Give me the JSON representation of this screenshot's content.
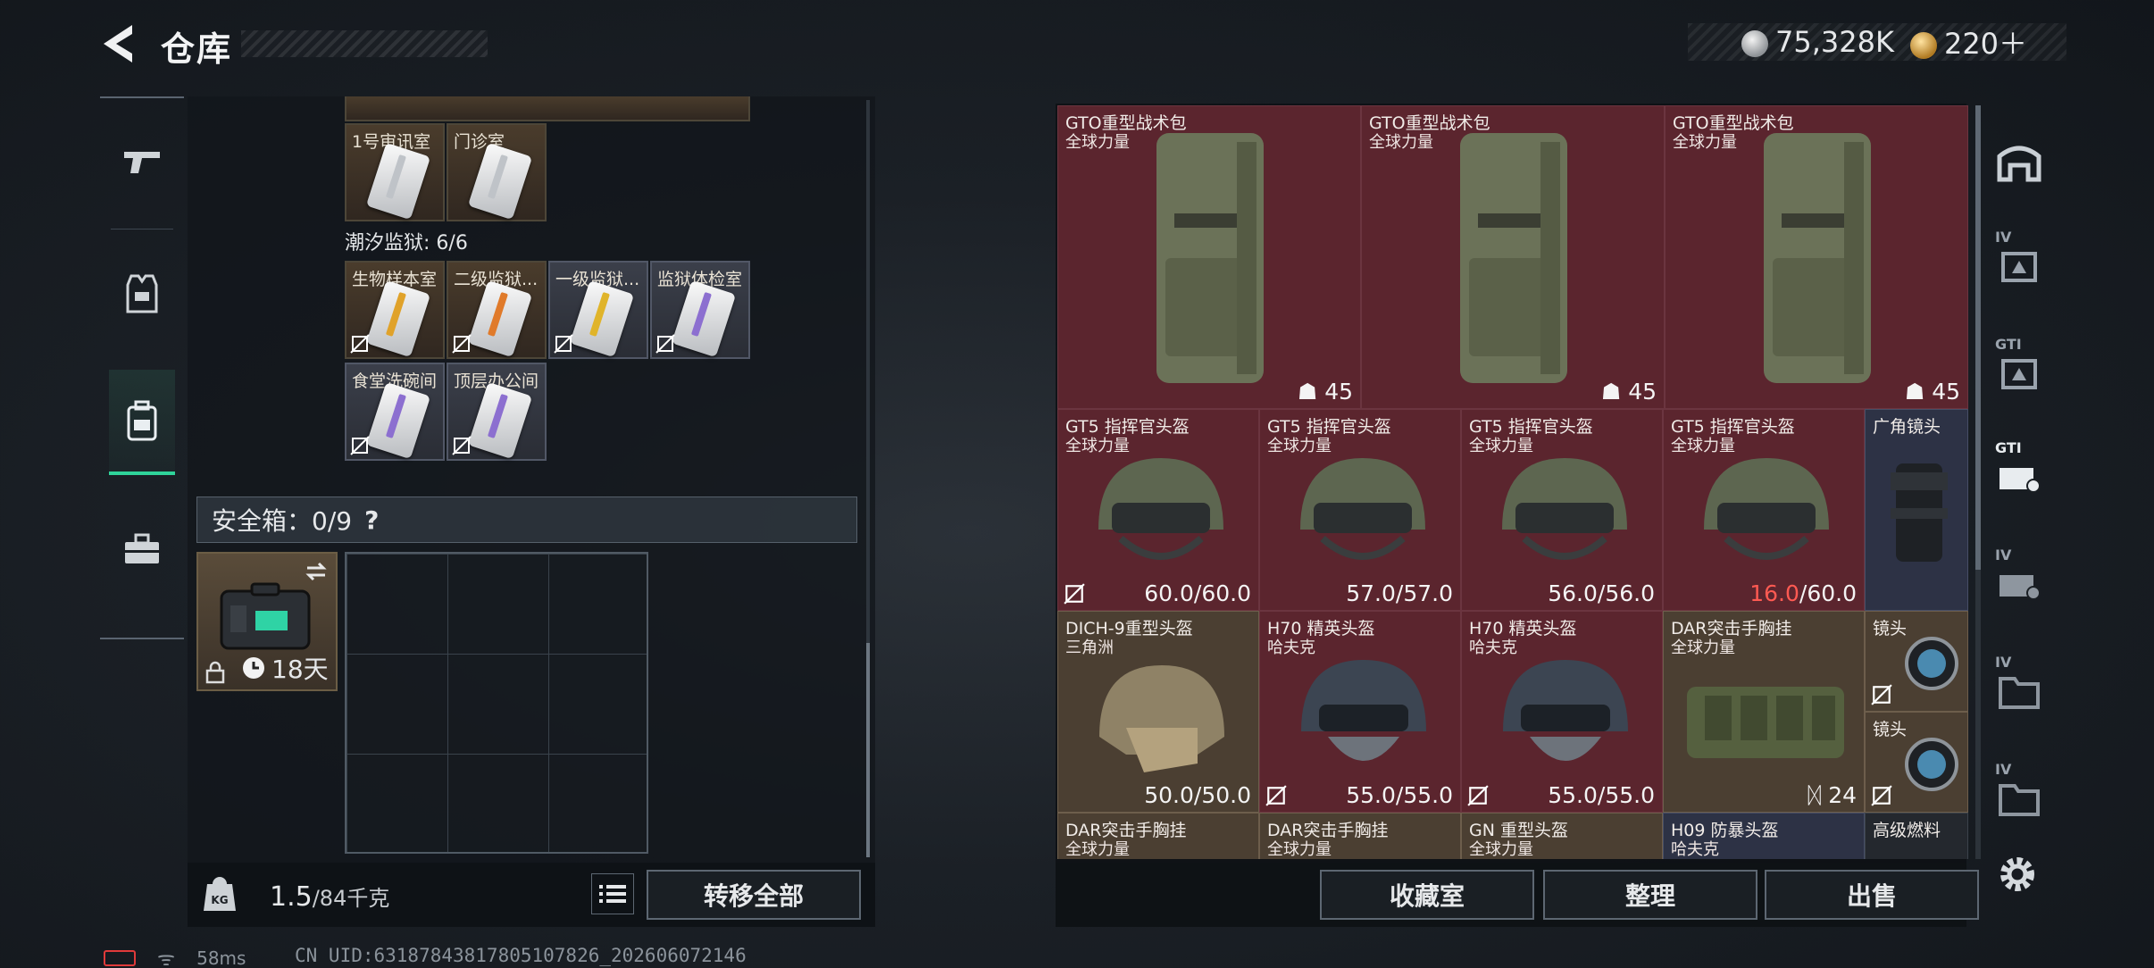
{
  "header": {
    "title": "仓库"
  },
  "currency": {
    "silver": "75,328K",
    "gold": "220＋"
  },
  "rail": {
    "items": [
      "weapons",
      "gear",
      "containers",
      "toolbox"
    ],
    "active": 2
  },
  "keys": {
    "row1": [
      {
        "label": "1号审讯室"
      },
      {
        "label": "门诊室"
      }
    ],
    "section_title": "潮汐监狱: 6/6",
    "row2": [
      {
        "label": "生物样本室"
      },
      {
        "label": "二级监狱..."
      },
      {
        "label": "一级监狱..."
      },
      {
        "label": "监狱体检室"
      }
    ],
    "row3": [
      {
        "label": "食堂洗碗间"
      },
      {
        "label": "顶层办公间"
      }
    ]
  },
  "safebox": {
    "label": "安全箱：0/9",
    "help": "?",
    "timer": "18天"
  },
  "bottom_left": {
    "weight": "1.5",
    "capacity": "/84千克",
    "transfer_label": "转移全部"
  },
  "stash": {
    "backpacks": [
      {
        "name": "GTO重型战术包",
        "sub": "全球力量",
        "stat": "45"
      },
      {
        "name": "GTO重型战术包",
        "sub": "全球力量",
        "stat": "45"
      },
      {
        "name": "GTO重型战术包",
        "sub": "全球力量",
        "stat": "45"
      }
    ],
    "helmets": [
      {
        "name": "GT5 指挥官头盔",
        "sub": "全球力量",
        "cur": "60.0",
        "max": "/60.0"
      },
      {
        "name": "GT5 指挥官头盔",
        "sub": "全球力量",
        "cur": "57.0",
        "max": "/57.0"
      },
      {
        "name": "GT5 指挥官头盔",
        "sub": "全球力量",
        "cur": "56.0",
        "max": "/56.0"
      },
      {
        "name": "GT5 指挥官头盔",
        "sub": "全球力量",
        "cur": "16.0",
        "max": "/60.0"
      }
    ],
    "lens_wide": {
      "name": "广角镜头"
    },
    "row3": [
      {
        "name": "DICH-9重型头盔",
        "sub": "三角洲",
        "stat": "50.0/50.0"
      },
      {
        "name": "H70 精英头盔",
        "sub": "哈夫克",
        "stat": "55.0/55.0"
      },
      {
        "name": "H70 精英头盔",
        "sub": "哈夫克",
        "stat": "55.0/55.0"
      },
      {
        "name": "DAR突击手胸挂",
        "sub": "全球力量",
        "stat": "24"
      }
    ],
    "lens": [
      {
        "name": "镜头"
      },
      {
        "name": "镜头"
      }
    ],
    "row4": [
      {
        "name": "DAR突击手胸挂",
        "sub": "全球力量"
      },
      {
        "name": "DAR突击手胸挂",
        "sub": "全球力量"
      },
      {
        "name": "GN 重型头盔",
        "sub": "全球力量"
      },
      {
        "name": "H09 防暴头盔",
        "sub": "哈夫克"
      },
      {
        "name": "高级燃料"
      }
    ]
  },
  "side_tabs": [
    {
      "tier": ""
    },
    {
      "tier": "IV"
    },
    {
      "tier": "GTI"
    },
    {
      "tier": "GTI"
    },
    {
      "tier": "IV"
    },
    {
      "tier": "IV"
    },
    {
      "tier": "IV"
    }
  ],
  "actions": {
    "collection": "收藏室",
    "sort": "整理",
    "sell": "出售"
  },
  "status": {
    "ping": "58ms",
    "uid": "CN UID:63187843817805107826_202606072146"
  }
}
